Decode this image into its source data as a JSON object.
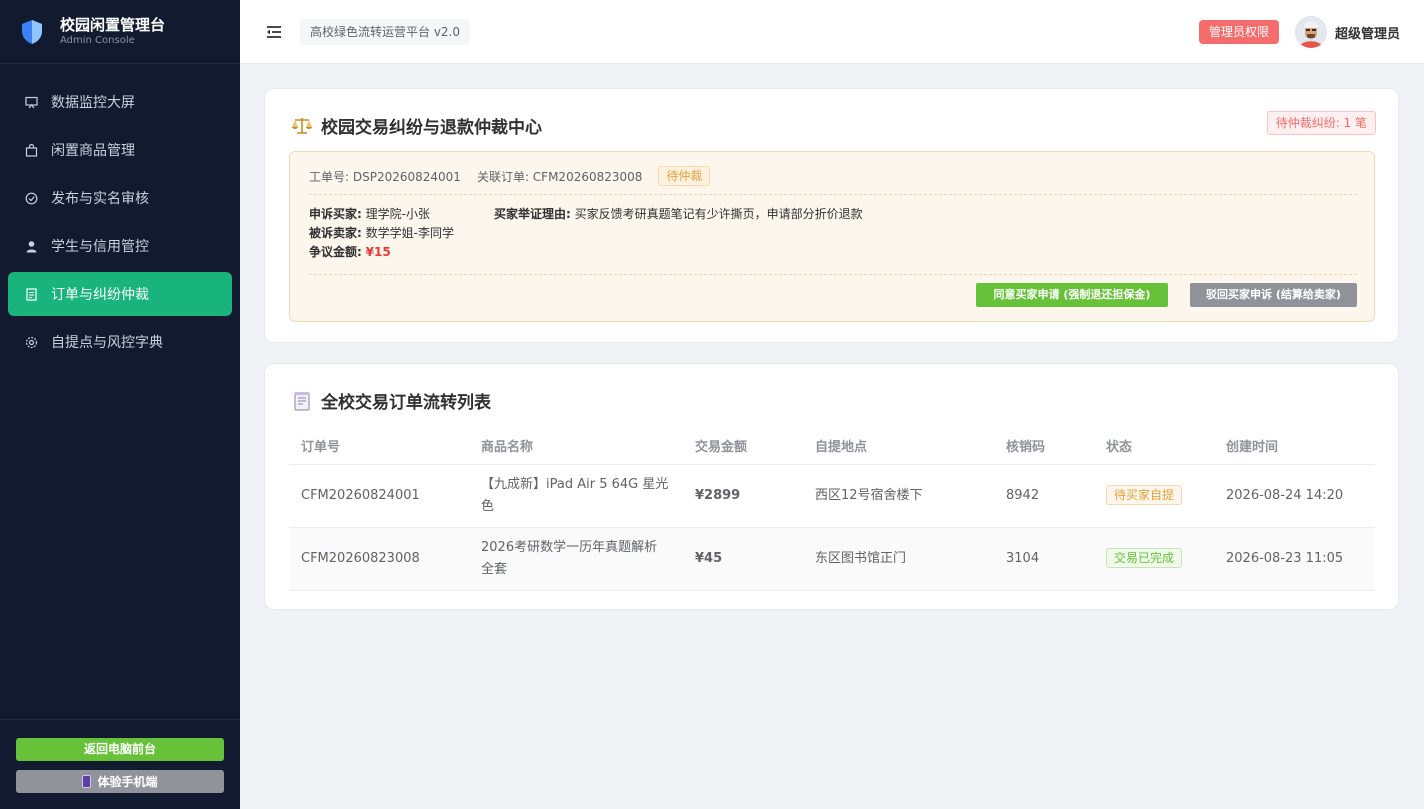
{
  "brand": {
    "title": "校园闲置管理台",
    "subtitle": "Admin Console"
  },
  "sidebar": {
    "items": [
      {
        "label": "数据监控大屏",
        "icon": "monitor-icon",
        "active": false
      },
      {
        "label": "闲置商品管理",
        "icon": "bag-icon",
        "active": false
      },
      {
        "label": "发布与实名审核",
        "icon": "check-circle-icon",
        "active": false
      },
      {
        "label": "学生与信用管控",
        "icon": "user-icon",
        "active": false
      },
      {
        "label": "订单与纠纷仲裁",
        "icon": "document-icon",
        "active": true
      },
      {
        "label": "自提点与风控字典",
        "icon": "gear-icon",
        "active": false
      }
    ],
    "back_front": "返回电脑前台",
    "mobile": "体验手机端"
  },
  "header": {
    "platform": "高校绿色流转运营平台 v2.0",
    "admin_badge": "管理员权限",
    "user_name": "超级管理员"
  },
  "dispute_center": {
    "title": "校园交易纠纷与退款仲裁中心",
    "pending_count": "待仲裁纠纷: 1 笔",
    "case": {
      "ticket": "工单号: DSP20260824001",
      "order": "关联订单: CFM20260823008",
      "status": "待仲裁",
      "buyer_label": "申诉买家:",
      "buyer": "理学院-小张",
      "seller_label": "被诉卖家:",
      "seller": "数学学姐-李同学",
      "amount_label": "争议金额:",
      "amount": "¥15",
      "reason_label": "买家举证理由:",
      "reason": "买家反馈考研真题笔记有少许撕页，申请部分折价退款",
      "agree_button": "同意买家申请 (强制退还担保金)",
      "reject_button": "驳回买家申诉 (结算给卖家)"
    }
  },
  "orders": {
    "title": "全校交易订单流转列表",
    "columns": [
      "订单号",
      "商品名称",
      "交易金额",
      "自提地点",
      "核销码",
      "状态",
      "创建时间"
    ],
    "rows": [
      {
        "order_no": "CFM20260824001",
        "product": "【九成新】iPad Air 5 64G 星光色",
        "amount": "¥2899",
        "location": "西区12号宿舍楼下",
        "code": "8942",
        "status": "待买家自提",
        "status_type": "warn",
        "created": "2026-08-24 14:20"
      },
      {
        "order_no": "CFM20260823008",
        "product": "2026考研数学一历年真题解析全套",
        "amount": "¥45",
        "location": "东区图书馆正门",
        "code": "3104",
        "status": "交易已完成",
        "status_type": "ok",
        "created": "2026-08-23 11:05"
      }
    ]
  },
  "colors": {
    "sidebar_bg": "#111a2e",
    "active": "#19b47c",
    "danger": "#f56c6c",
    "success": "#67c23a",
    "warning": "#e6a23c"
  }
}
